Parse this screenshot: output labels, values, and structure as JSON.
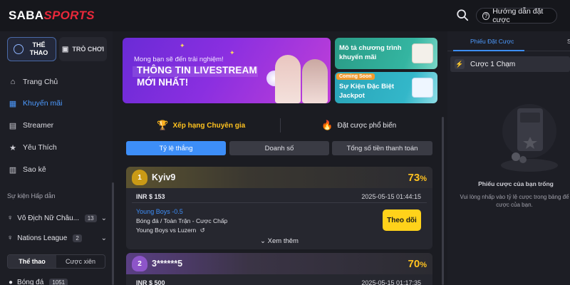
{
  "header": {
    "logo_part1": "SABA",
    "logo_part2": "SPORTS",
    "guide_label": "Hướng dẫn đặt cược",
    "guide_icon": "?"
  },
  "sidebar": {
    "tabs": [
      {
        "label": "THỂ THAO",
        "active": true
      },
      {
        "label": "TRÒ CHƠI",
        "active": false
      }
    ],
    "items": [
      {
        "label": "Trang Chủ",
        "icon": "home-icon"
      },
      {
        "label": "Khuyến mãi",
        "icon": "gift-icon",
        "active": true
      },
      {
        "label": "Streamer",
        "icon": "streamer-icon"
      },
      {
        "label": "Yêu Thích",
        "icon": "star-icon"
      },
      {
        "label": "Sao kê",
        "icon": "statement-icon"
      }
    ],
    "section_title": "Sự kiện Hấp dẫn",
    "events": [
      {
        "label": "Vô Địch Nữ Châu...",
        "count": "13"
      },
      {
        "label": "Nations League",
        "count": "2"
      }
    ],
    "sub_tabs": [
      "Thể thao",
      "Cược xiên"
    ],
    "last_item": {
      "label": "Bóng đá",
      "count": "1051"
    }
  },
  "banners": {
    "big": {
      "line1": "Mong bạn sẽ đến trải nghiệm!",
      "line2": "THÔNG TIN LIVESTREAM",
      "line3": "MỚI NHẤT!"
    },
    "small1": {
      "line1": "Mô tả chương trình",
      "line2": "khuyến mãi"
    },
    "small2": {
      "badge": "Coming Soon",
      "line1": "Sự Kiện Đặc Biệt",
      "line2": "Jackpot"
    }
  },
  "categories": [
    {
      "label": "Xếp hạng Chuyên gia",
      "icon": "trophy-icon",
      "active": true
    },
    {
      "label": "Đặt cược phổ biến",
      "icon": "fire-icon",
      "active": false
    }
  ],
  "segments": [
    "Tỷ lệ thắng",
    "Doanh số",
    "Tổng số tiền thanh toán"
  ],
  "cards": [
    {
      "rank": "1",
      "user": "Kyiv9",
      "percent": "73",
      "percent_unit": "%",
      "amount": "INR $ 153",
      "time": "2025-05-15 01:44:15",
      "bet_pick": "Young Boys -0.5",
      "bet_market": "Bóng đá / Toàn Trận - Cược Chấp",
      "bet_match": "Young Boys vs Luzern",
      "follow_label": "Theo dõi",
      "more_label": "Xem thêm"
    },
    {
      "rank": "2",
      "user": "3******5",
      "percent": "70",
      "percent_unit": "%",
      "amount": "INR $ 500",
      "time": "2025-05-15 01:17:35"
    }
  ],
  "right_panel": {
    "tabs": [
      "Phiếu Đặt Cược",
      "S"
    ],
    "one_click": "Cược 1 Chạm",
    "empty_title": "Phiếu cược của bạn trống",
    "hint_line1": "Vui lòng nhấp vào tỷ lệ cược trong bảng để",
    "hint_line2": "cược của bạn."
  },
  "colors": {
    "accent_blue": "#3d8ef8",
    "gold": "#ffc21f",
    "follow_button": "#ffd21a",
    "brand_red": "#e8283a"
  }
}
